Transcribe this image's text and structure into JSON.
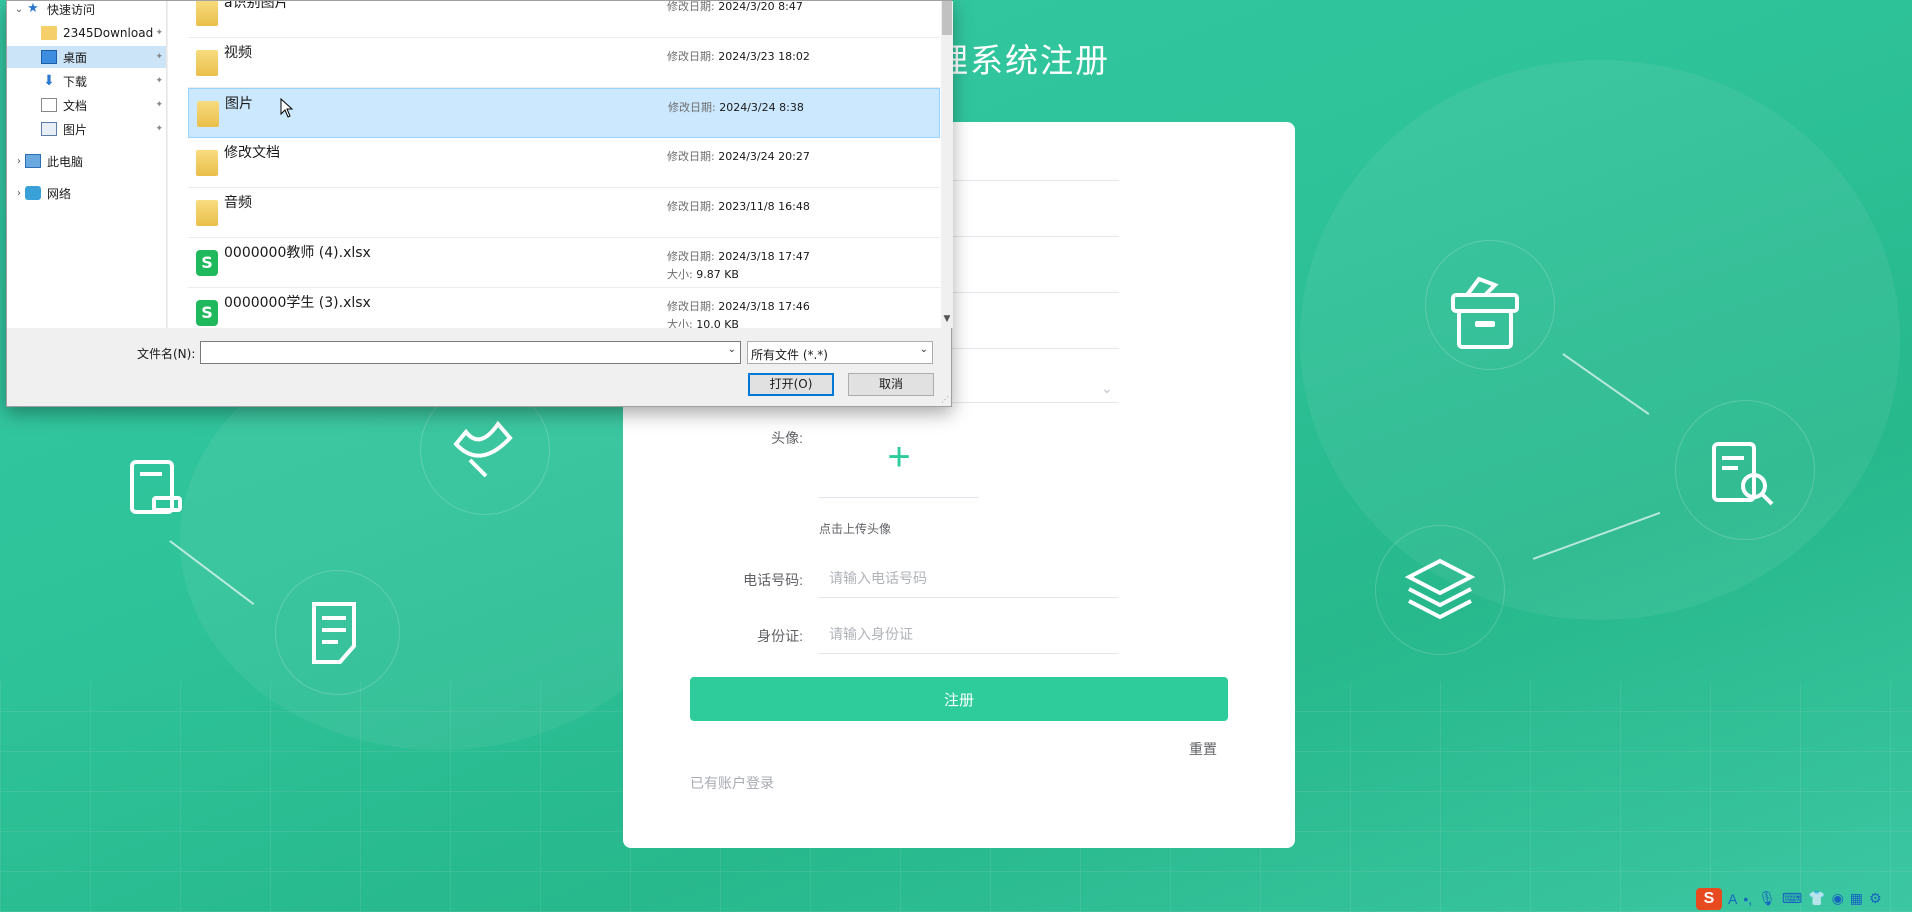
{
  "background": {
    "accent": "#2ecc9a"
  },
  "page": {
    "title": "理系统注册"
  },
  "form": {
    "avatar_label": "头像:",
    "avatar_hint": "点击上传头像",
    "phone_label": "电话号码:",
    "phone_placeholder": "请输入电话号码",
    "idcard_label": "身份证:",
    "idcard_placeholder": "请输入身份证",
    "register_button": "注册",
    "reset_link": "重置",
    "login_link": "已有账户登录"
  },
  "dialog": {
    "nav_items": [
      {
        "label": "快速访问",
        "icon": "star-icon"
      },
      {
        "label": "2345Download",
        "icon": "folder-icon"
      },
      {
        "label": "桌面",
        "icon": "desktop-icon"
      },
      {
        "label": "下载",
        "icon": "download-icon"
      },
      {
        "label": "文档",
        "icon": "document-icon"
      },
      {
        "label": "图片",
        "icon": "picture-icon"
      },
      {
        "label": "此电脑",
        "icon": "computer-icon"
      },
      {
        "label": "网络",
        "icon": "network-icon"
      }
    ],
    "files": [
      {
        "name": "a识别图片",
        "date_label": "修改日期:",
        "date": "2024/3/20 8:47",
        "size_label": "",
        "size": "",
        "type": "folder"
      },
      {
        "name": "视频",
        "date_label": "修改日期:",
        "date": "2024/3/23 18:02",
        "size_label": "",
        "size": "",
        "type": "folder"
      },
      {
        "name": "图片",
        "date_label": "修改日期:",
        "date": "2024/3/24 8:38",
        "size_label": "",
        "size": "",
        "type": "folder"
      },
      {
        "name": "修改文档",
        "date_label": "修改日期:",
        "date": "2024/3/24 20:27",
        "size_label": "",
        "size": "",
        "type": "folder"
      },
      {
        "name": "音频",
        "date_label": "修改日期:",
        "date": "2023/11/8 16:48",
        "size_label": "",
        "size": "",
        "type": "folder"
      },
      {
        "name": "0000000教师 (4).xlsx",
        "date_label": "修改日期:",
        "date": "2024/3/18 17:47",
        "size_label": "大小:",
        "size": "9.87 KB",
        "type": "xlsx"
      },
      {
        "name": "0000000学生 (3).xlsx",
        "date_label": "修改日期:",
        "date": "2024/3/18 17:46",
        "size_label": "大小:",
        "size": "10.0 KB",
        "type": "xlsx"
      }
    ],
    "filename_label": "文件名(N):",
    "filename_value": "",
    "filetype_value": "所有文件 (*.*)",
    "open_button": "打开(O)",
    "cancel_button": "取消"
  },
  "ime": {
    "logo": "S",
    "mode": "A"
  }
}
